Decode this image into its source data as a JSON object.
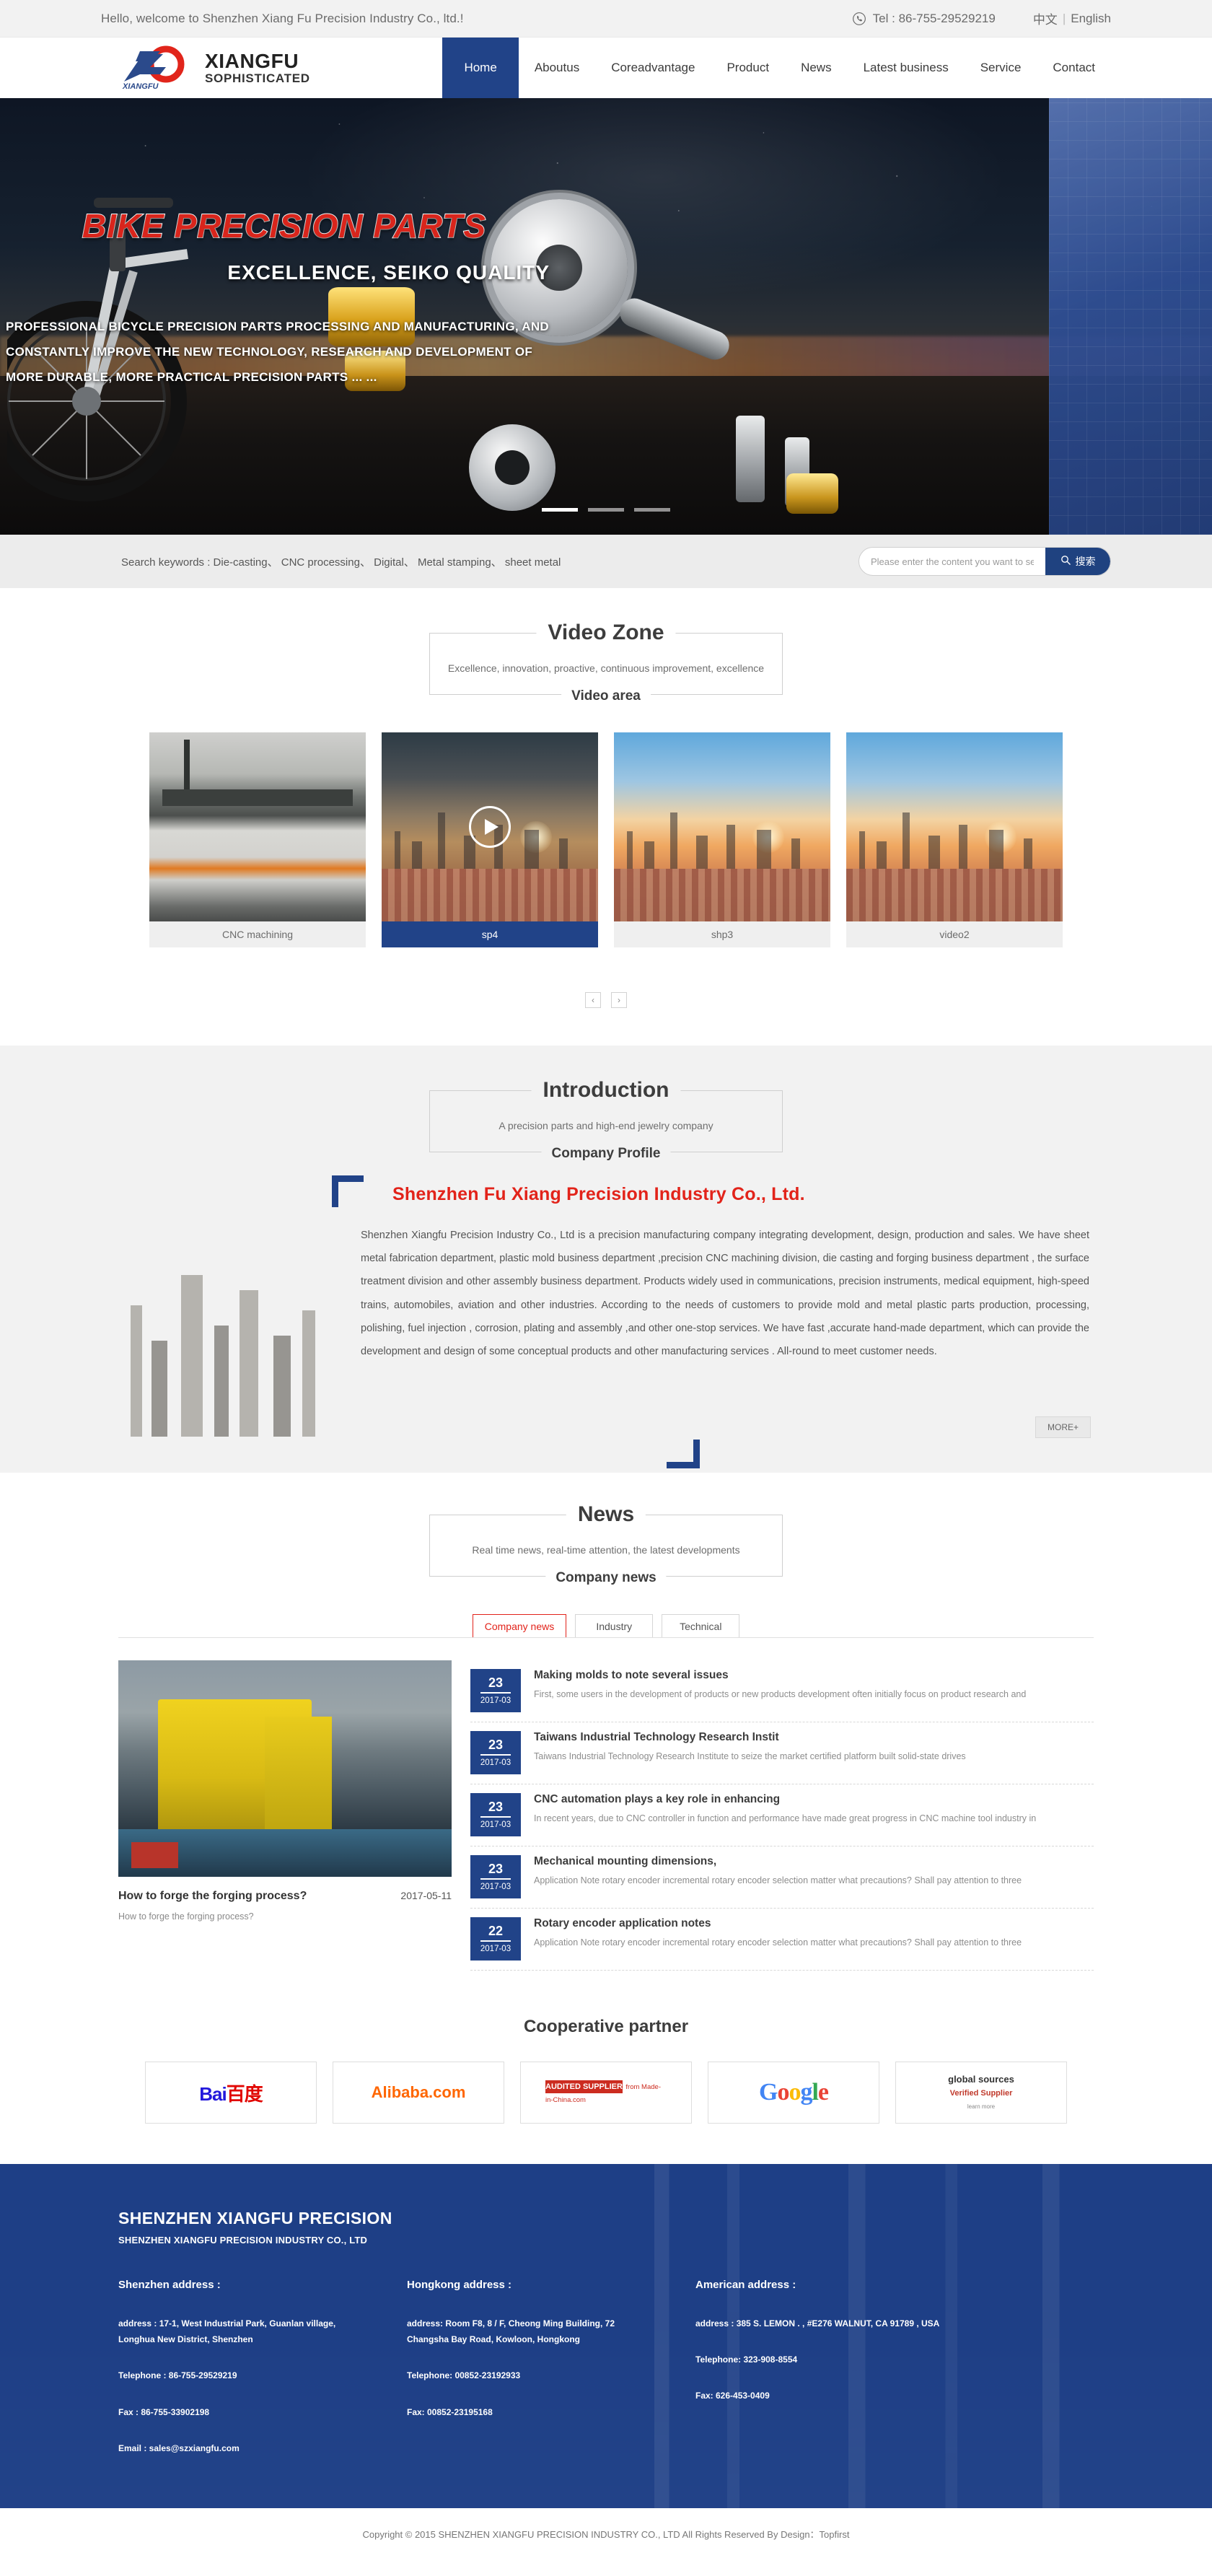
{
  "topbar": {
    "welcome": "Hello, welcome to Shenzhen Xiang Fu Precision Industry Co., ltd.!",
    "tel": "Tel : 86-755-29529219",
    "lang_cn": "中文",
    "lang_sep": "|",
    "lang_en": "English",
    "phone_icon": "phone-icon"
  },
  "header": {
    "logo_line1": "XIANGFU",
    "logo_line2": "SOPHISTICATED",
    "logo_mark_text": "XIANGFU",
    "nav": [
      {
        "label": "Home",
        "active": true
      },
      {
        "label": "Aboutus",
        "active": false
      },
      {
        "label": "Coreadvantage",
        "active": false
      },
      {
        "label": "Product",
        "active": false
      },
      {
        "label": "News",
        "active": false
      },
      {
        "label": "Latest business",
        "active": false
      },
      {
        "label": "Service",
        "active": false
      },
      {
        "label": "Contact",
        "active": false
      }
    ]
  },
  "banner": {
    "title": "BIKE PRECISION PARTS",
    "subtitle": "EXCELLENCE, SEIKO QUALITY",
    "desc_line1": "PROFESSIONAL BICYCLE PRECISION PARTS PROCESSING AND MANUFACTURING, AND",
    "desc_line2": "CONSTANTLY IMPROVE THE NEW TECHNOLOGY, RESEARCH AND DEVELOPMENT OF",
    "desc_line3": "MORE DURABLE, MORE PRACTICAL PRECISION PARTS ... ...",
    "slide_count": 3,
    "active_slide": 1
  },
  "search": {
    "keywords_label": "Search keywords : Die-casting、 CNC processing、 Digital、 Metal stamping、 sheet metal",
    "placeholder": "Please enter the content you want to search",
    "button_label": "搜索",
    "button_icon": "search-icon"
  },
  "video_section": {
    "title": "Video Zone",
    "subtitle": "Excellence, innovation, proactive, continuous improvement, excellence",
    "name": "Video area",
    "items": [
      {
        "label": "CNC machining",
        "active": false,
        "has_play": false,
        "thumb": "factory"
      },
      {
        "label": "sp4",
        "active": true,
        "has_play": true,
        "thumb": "city-dark"
      },
      {
        "label": "shp3",
        "active": false,
        "has_play": false,
        "thumb": "city"
      },
      {
        "label": "video2",
        "active": false,
        "has_play": false,
        "thumb": "city"
      }
    ],
    "prev_label": "‹",
    "next_label": "›"
  },
  "intro_section": {
    "title": "Introduction",
    "subtitle": "A precision parts and high-end jewelry company",
    "name": "Company Profile",
    "company_title": "Shenzhen Fu Xiang Precision Industry Co., Ltd.",
    "body": "Shenzhen Xiangfu Precision Industry Co., Ltd is a precision manufacturing company integrating development, design, production and sales. We have sheet metal fabrication department, plastic mold business department ,precision CNC machining division, die casting and forging business department , the surface treatment division and other assembly business department. Products widely used in communications, precision instruments, medical equipment, high-speed trains, automobiles, aviation and other industries. According to the needs of customers to provide mold and metal plastic parts production, processing, polishing, fuel injection , corrosion, plating and assembly ,and other one-stop services. We have fast ,accurate hand-made department, which can provide the development and design of some conceptual products and other manufacturing services . All-round to meet customer needs.",
    "more_label": "MORE+"
  },
  "news_section": {
    "title": "News",
    "subtitle": "Real time news, real-time attention, the latest developments",
    "name": "Company news",
    "tabs": [
      {
        "label": "Company news",
        "active": true
      },
      {
        "label": "Industry",
        "active": false
      },
      {
        "label": "Technical",
        "active": false
      }
    ],
    "feature": {
      "title": "How to forge the forging process?",
      "date": "2017-05-11",
      "excerpt": "How to forge the forging process?"
    },
    "items": [
      {
        "day": "23",
        "month": "2017-03",
        "title": "Making molds to note several issues",
        "excerpt": "First, some users in the development of products or new products development often initially focus on product research and"
      },
      {
        "day": "23",
        "month": "2017-03",
        "title": "Taiwans Industrial Technology Research Instit",
        "excerpt": "Taiwans Industrial Technology Research Institute to seize the market certified platform built solid-state drives"
      },
      {
        "day": "23",
        "month": "2017-03",
        "title": "CNC automation plays a key role in enhancing",
        "excerpt": "In recent years, due to CNC controller in function and performance have made great progress in CNC machine tool industry in"
      },
      {
        "day": "23",
        "month": "2017-03",
        "title": "Mechanical mounting dimensions,",
        "excerpt": "Application Note rotary encoder incremental rotary encoder selection matter what precautions? Shall pay attention to three"
      },
      {
        "day": "22",
        "month": "2017-03",
        "title": "Rotary encoder application notes",
        "excerpt": "Application Note rotary encoder incremental rotary encoder selection matter what precautions? Shall pay attention to three"
      }
    ]
  },
  "partners": {
    "title": "Cooperative partner",
    "items": [
      {
        "name": "Baidu",
        "type": "baidu",
        "text_a": "Bai",
        "text_b": "百度"
      },
      {
        "name": "Alibaba",
        "type": "alibaba",
        "text": "Alibaba.com"
      },
      {
        "name": "Made-in-China",
        "type": "made",
        "text_a": "AUDITED SUPPLIER",
        "text_b": "from Made-in-China.com"
      },
      {
        "name": "Google",
        "type": "google",
        "letters": [
          "G",
          "o",
          "o",
          "g",
          "l",
          "e"
        ]
      },
      {
        "name": "Global Sources",
        "type": "gsources",
        "text_a": "global sources",
        "text_b": "Verified Supplier",
        "text_c": "learn more"
      }
    ]
  },
  "footer": {
    "brand": "SHENZHEN XIANGFU PRECISION",
    "brand_sub": "SHENZHEN XIANGFU PRECISION INDUSTRY CO., LTD",
    "columns": [
      {
        "heading": "Shenzhen address :",
        "address": "address : 17-1, West Industrial Park, Guanlan village, Longhua New District, Shenzhen",
        "telephone": "Telephone : 86-755-29529219",
        "fax": "Fax : 86-755-33902198",
        "email": "Email : sales@szxiangfu.com"
      },
      {
        "heading": "Hongkong address :",
        "address": "address: Room F8, 8 / F, Cheong Ming Building, 72 Changsha Bay Road, Kowloon, Hongkong",
        "telephone": "Telephone: 00852-23192933",
        "fax": "Fax: 00852-23195168",
        "email": ""
      },
      {
        "heading": "American address :",
        "address": "address : 385 S. LEMON . , #E276 WALNUT, CA 91789 , USA",
        "telephone": "Telephone: 323-908-8554",
        "fax": "Fax: 626-453-0409",
        "email": ""
      }
    ],
    "copyright": "Copyright © 2015 SHENZHEN XIANGFU PRECISION INDUSTRY CO., LTD All Rights Reserved By Design：Topfirst"
  },
  "colors": {
    "brand_blue": "#214388",
    "brand_red": "#e2231a",
    "footer_blue": "#1e3f86",
    "topbar_bg": "#f2f2f2"
  }
}
